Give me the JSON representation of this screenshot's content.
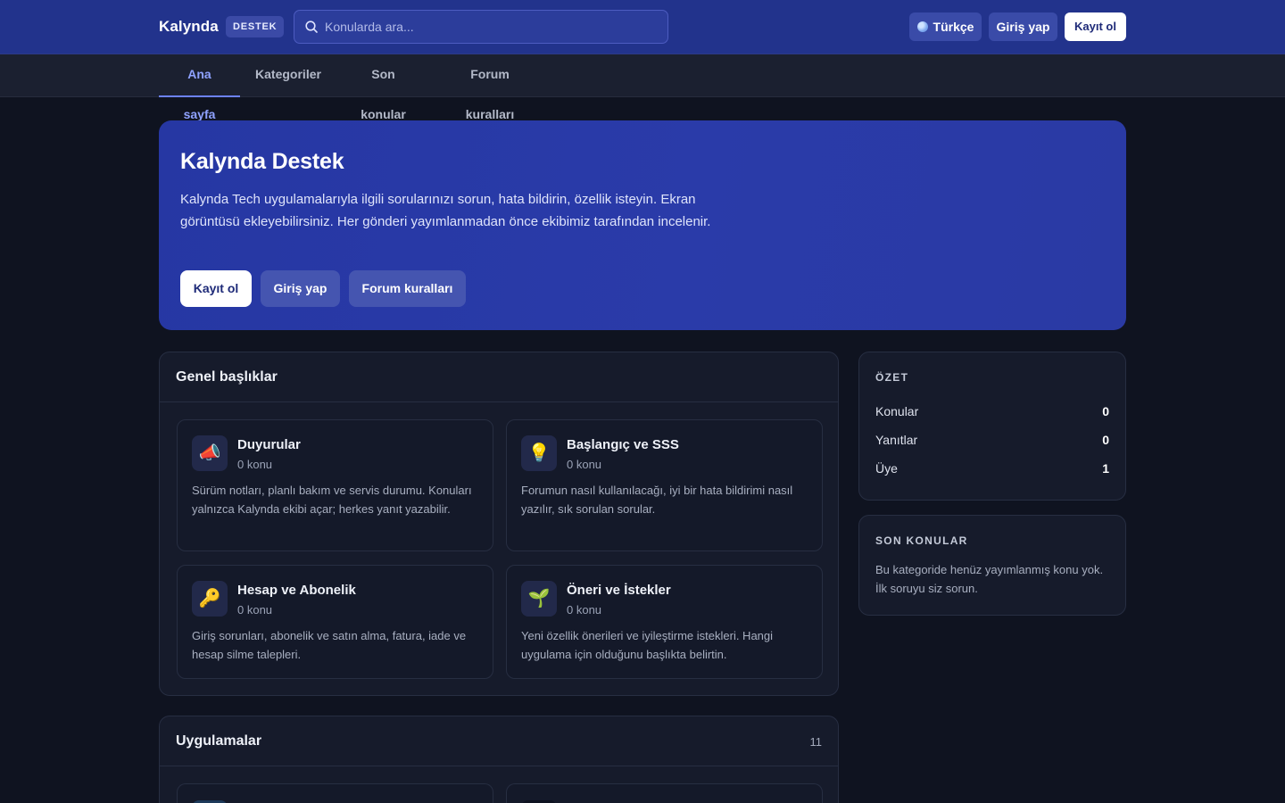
{
  "header": {
    "brand": "Kalynda",
    "badge": "DESTEK",
    "search_placeholder": "Konularda ara...",
    "language_label": "Türkçe",
    "login_label": "Giriş yap",
    "register_label": "Kayıt ol"
  },
  "nav": {
    "tabs": [
      {
        "label": "Ana sayfa",
        "active": true
      },
      {
        "label": "Kategoriler",
        "active": false
      },
      {
        "label": "Son konular",
        "active": false
      },
      {
        "label": "Forum kuralları",
        "active": false
      }
    ]
  },
  "hero": {
    "title": "Kalynda Destek",
    "description": "Kalynda Tech uygulamalarıyla ilgili sorularınızı sorun, hata bildirin, özellik isteyin. Ekran görüntüsü ekleyebilirsiniz. Her gönderi yayımlanmadan önce ekibimiz tarafından incelenir.",
    "buttons": {
      "register": "Kayıt ol",
      "login": "Giriş yap",
      "rules": "Forum kuralları"
    }
  },
  "general": {
    "title": "Genel başlıklar",
    "cards": [
      {
        "icon": "megaphone-icon",
        "glyph": "📣",
        "title": "Duyurular",
        "meta": "0 konu",
        "desc": "Sürüm notları, planlı bakım ve servis durumu. Konuları yalnızca Kalynda ekibi açar; herkes yanıt yazabilir."
      },
      {
        "icon": "lightbulb-icon",
        "glyph": "💡",
        "title": "Başlangıç ve SSS",
        "meta": "0 konu",
        "desc": "Forumun nasıl kullanılacağı, iyi bir hata bildirimi nasıl yazılır, sık sorulan sorular."
      },
      {
        "icon": "key-icon",
        "glyph": "🔑",
        "title": "Hesap ve Abonelik",
        "meta": "0 konu",
        "desc": "Giriş sorunları, abonelik ve satın alma, fatura, iade ve hesap silme talepleri."
      },
      {
        "icon": "seedling-icon",
        "glyph": "🌱",
        "title": "Öneri ve İstekler",
        "meta": "0 konu",
        "desc": "Yeni özellik önerileri ve iyileştirme istekleri. Hangi uygulama için olduğunu başlıkta belirtin."
      }
    ]
  },
  "apps": {
    "title": "Uygulamalar",
    "count": "11"
  },
  "summary": {
    "label": "ÖZET",
    "rows": [
      {
        "label": "Konular",
        "value": "0"
      },
      {
        "label": "Yanıtlar",
        "value": "0"
      },
      {
        "label": "Üye",
        "value": "1"
      }
    ]
  },
  "recent": {
    "label": "SON KONULAR",
    "text": "Bu kategoride henüz yayımlanmış konu yok. İlk soruyu siz sorun."
  },
  "colors": {
    "header_bg": "#22338c",
    "accent": "#6c82ff",
    "page_bg": "#0f1320"
  }
}
